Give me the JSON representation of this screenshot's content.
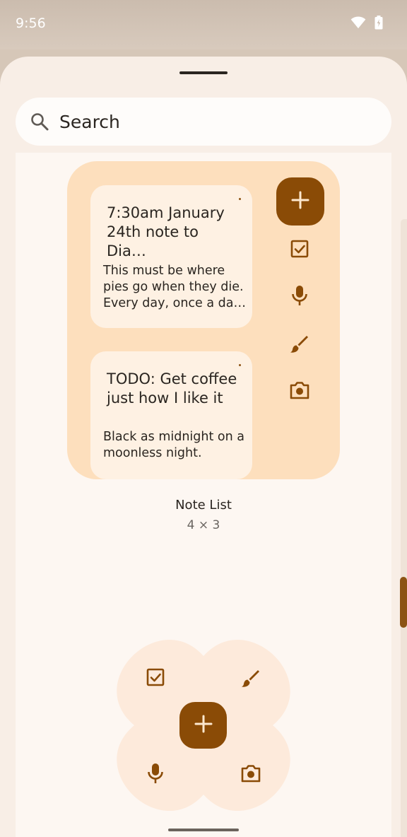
{
  "status_bar": {
    "time": "9:56"
  },
  "search": {
    "label": "Search"
  },
  "note_list_widget": {
    "notes": [
      {
        "title": "7:30am January 24th note to Dia…",
        "body": "This must be where pies go when they die. Every day, once a da…"
      },
      {
        "title": "TODO: Get coffee just how I like it",
        "body": "Black as midnight on a moonless night."
      }
    ],
    "name": "Note List",
    "size": "4 × 3"
  },
  "colors": {
    "accent": "#8a4b06",
    "widget_bg": "#fddfbd",
    "note_bg": "#fef1e3",
    "sheet_bg": "#f8eee6",
    "quad_bg": "#fdeadb"
  },
  "icons": [
    "search-icon",
    "plus-icon",
    "checkbox-icon",
    "mic-icon",
    "brush-icon",
    "camera-icon",
    "wifi-icon",
    "battery-icon"
  ]
}
